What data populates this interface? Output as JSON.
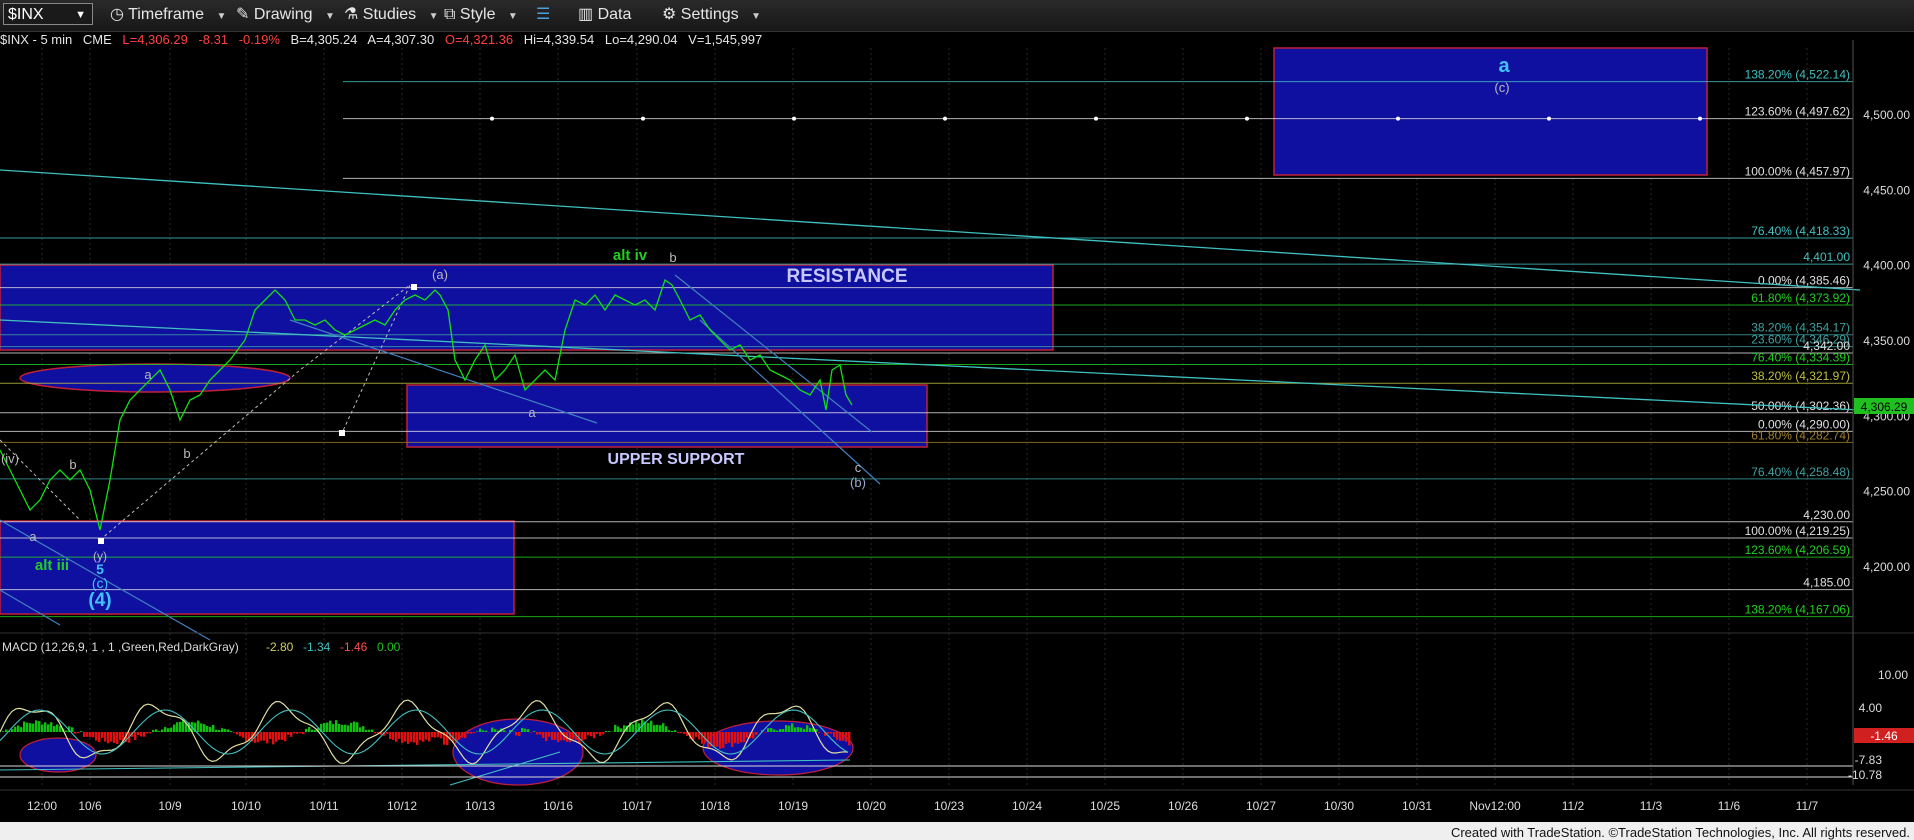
{
  "toolbar": {
    "symbol": "$INX",
    "timeframe_label": "Timeframe",
    "drawing_label": "Drawing",
    "studies_label": "Studies",
    "style_label": "Style",
    "data_label": "Data",
    "settings_label": "Settings"
  },
  "quote": {
    "symbol_interval": "$INX - 5 min",
    "exchange": "CME",
    "last": "L=4,306.29",
    "change": "-8.31",
    "change_pct": "-0.19%",
    "bid": "B=4,305.24",
    "ask": "A=4,307.30",
    "open": "O=4,321.36",
    "high": "Hi=4,339.54",
    "low": "Lo=4,290.04",
    "volume": "V=1,545,997"
  },
  "colors": {
    "last_up": "#ff4040",
    "box_blue": "#1010a0",
    "box_border": "#c0203a",
    "price_line": "#10e010",
    "fib_green": "#20d020",
    "fib_white": "#e0e0e0",
    "teal": "#40c0c0"
  },
  "price_axis": {
    "ticks": [
      "4,500.00",
      "4,450.00",
      "4,400.00",
      "4,350.00",
      "4,300.00",
      "4,250.00",
      "4,200.00"
    ],
    "last_price_tag": "4,306.29"
  },
  "macd_axis": {
    "ticks": [
      "10.00",
      "4.00",
      "-7.83",
      "-10.78"
    ],
    "current_tag": "-1.46"
  },
  "date_axis": [
    "12:00",
    "10/6",
    "10/9",
    "10/10",
    "10/11",
    "10/12",
    "10/13",
    "10/16",
    "10/17",
    "10/18",
    "10/19",
    "10/20",
    "10/23",
    "10/24",
    "10/25",
    "10/26",
    "10/27",
    "10/30",
    "10/31",
    "Nov12:00",
    "11/2",
    "11/3",
    "11/6",
    "11/7"
  ],
  "fib_levels": [
    {
      "label": "138.20% (4,522.14)",
      "color": "#40c0c0"
    },
    {
      "label": "123.60% (4,497.62)",
      "color": "#e0e0e0"
    },
    {
      "label": "100.00% (4,457.97)",
      "color": "#e0e0e0"
    },
    {
      "label": "76.40% (4,418.33)",
      "color": "#40c0c0"
    },
    {
      "label": "4,401.00",
      "color": "#40c0c0"
    },
    {
      "label": "0.00% (4,385.46)",
      "color": "#e0e0e0"
    },
    {
      "label": "61.80% (4,373.92)",
      "color": "#20d020"
    },
    {
      "label": "38.20% (4,354.17)",
      "color": "#40a0a0"
    },
    {
      "label": "23.60% (4,346.29)",
      "color": "#40a0a0"
    },
    {
      "label": "4,342.00",
      "color": "#e0e0e0"
    },
    {
      "label": "76.40% (4,334.39)",
      "color": "#20d020"
    },
    {
      "label": "38.20% (4,321.97)",
      "color": "#c0c040"
    },
    {
      "label": "50.00% (4,302.36)",
      "color": "#e0e0e0"
    },
    {
      "label": "0.00% (4,290.00)",
      "color": "#e0e0e0"
    },
    {
      "label": "61.80% (4,282.74)",
      "color": "#a08030"
    },
    {
      "label": "76.40% (4,258.48)",
      "color": "#40a0a0"
    },
    {
      "label": "4,230.00",
      "color": "#e0e0e0"
    },
    {
      "label": "100.00% (4,219.25)",
      "color": "#e0e0e0"
    },
    {
      "label": "123.60% (4,206.59)",
      "color": "#20d020"
    },
    {
      "label": "4,185.00",
      "color": "#e0e0e0"
    },
    {
      "label": "138.20% (4,167.06)",
      "color": "#20d020"
    }
  ],
  "annotations": {
    "resistance": "RESISTANCE",
    "upper_support": "UPPER SUPPORT",
    "alt_iv": "alt iv",
    "alt_iii": "alt iii",
    "wave_a_top": "a",
    "wave_c_top": "(c)",
    "wave_a_paren": "(a)",
    "wave_b_top": "b",
    "wave_b_paren": "(b)",
    "wave_c_small": "c",
    "wave_a_mid": "a",
    "wave_a_left": "a",
    "wave_b_left": "b",
    "wave_iv": "(iv)",
    "wave_b_far": "b",
    "wave_a_far": "a",
    "wave_y": "(y)",
    "wave_5": "5",
    "wave_c_paren": "(c)",
    "wave_4": "(4)"
  },
  "macd": {
    "label": "MACD (12,26,9, 1 , 1 ,Green,Red,DarkGray)",
    "v1": "-2.80",
    "v2": "-1.34",
    "v3": "-1.46",
    "v4": "0.00"
  },
  "footer": "Created with TradeStation. ©TradeStation Technologies, Inc. All rights reserved."
}
